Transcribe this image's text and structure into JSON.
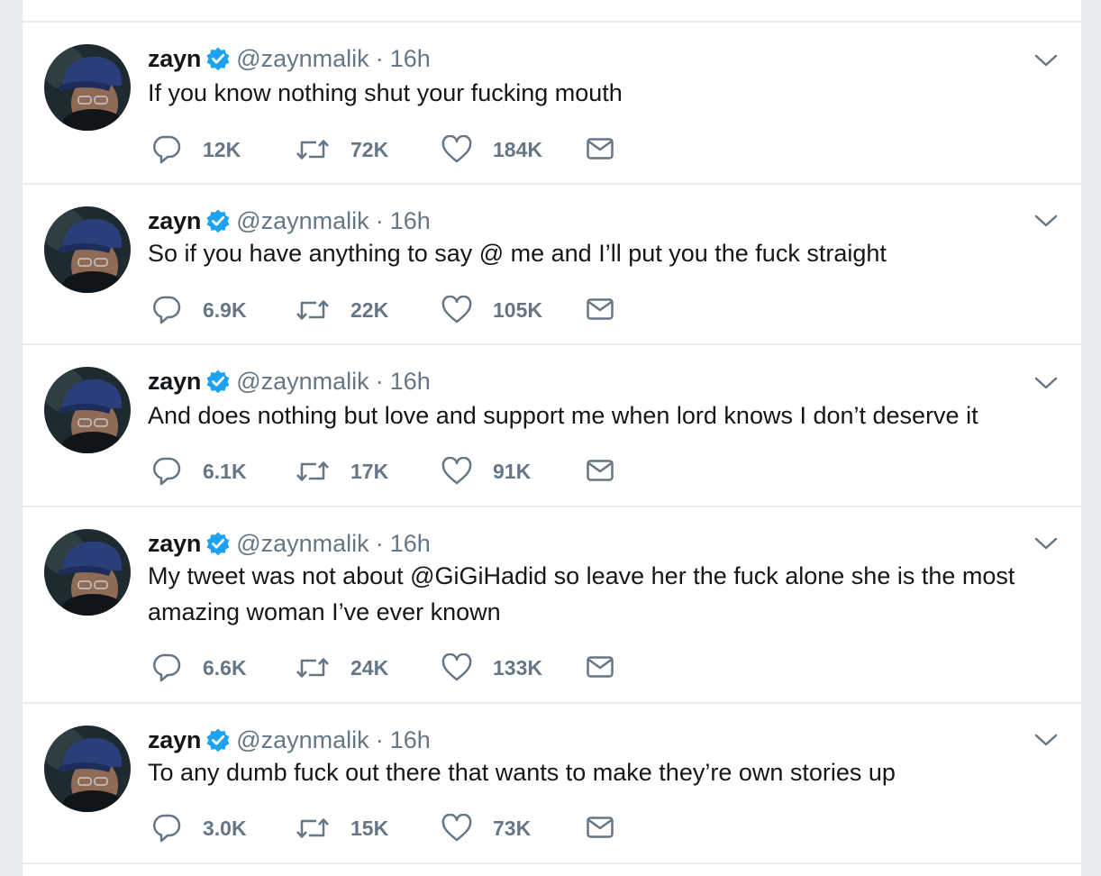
{
  "tweets": [
    {
      "name": "zayn",
      "handle": "@zaynmalik",
      "separator": "·",
      "time": "16h",
      "lines": [
        "If you know nothing shut your fucking mouth"
      ],
      "replies": "12K",
      "retweets": "72K",
      "likes": "184K"
    },
    {
      "name": "zayn",
      "handle": "@zaynmalik",
      "separator": "·",
      "time": "16h",
      "lines": [
        "So if you have anything to say @ me and I’ll put you the fuck straight"
      ],
      "replies": "6.9K",
      "retweets": "22K",
      "likes": "105K"
    },
    {
      "name": "zayn",
      "handle": "@zaynmalik",
      "separator": "·",
      "time": "16h",
      "lines": [
        "And does nothing but love and support me when lord knows I don’t deserve it"
      ],
      "replies": "6.1K",
      "retweets": "17K",
      "likes": "91K"
    },
    {
      "name": "zayn",
      "handle": "@zaynmalik",
      "separator": "·",
      "time": "16h",
      "lines": [
        "My tweet was not about @GiGiHadid so leave her the fuck alone she is the most",
        "amazing woman I’ve ever known"
      ],
      "replies": "6.6K",
      "retweets": "24K",
      "likes": "133K"
    },
    {
      "name": "zayn",
      "handle": "@zaynmalik",
      "separator": "·",
      "time": "16h",
      "lines": [
        "To any dumb fuck out there that wants to make they’re own stories up"
      ],
      "replies": "3.0K",
      "retweets": "15K",
      "likes": "73K"
    }
  ],
  "icons": {
    "verified": "verified-badge-icon",
    "caret": "chevron-down-icon",
    "reply": "reply-icon",
    "retweet": "retweet-icon",
    "like": "heart-icon",
    "dm": "envelope-icon"
  },
  "colors": {
    "background": "#e6ecf0",
    "card": "#ffffff",
    "text": "#14171a",
    "secondary": "#657786",
    "verified": "#1da1f2"
  }
}
